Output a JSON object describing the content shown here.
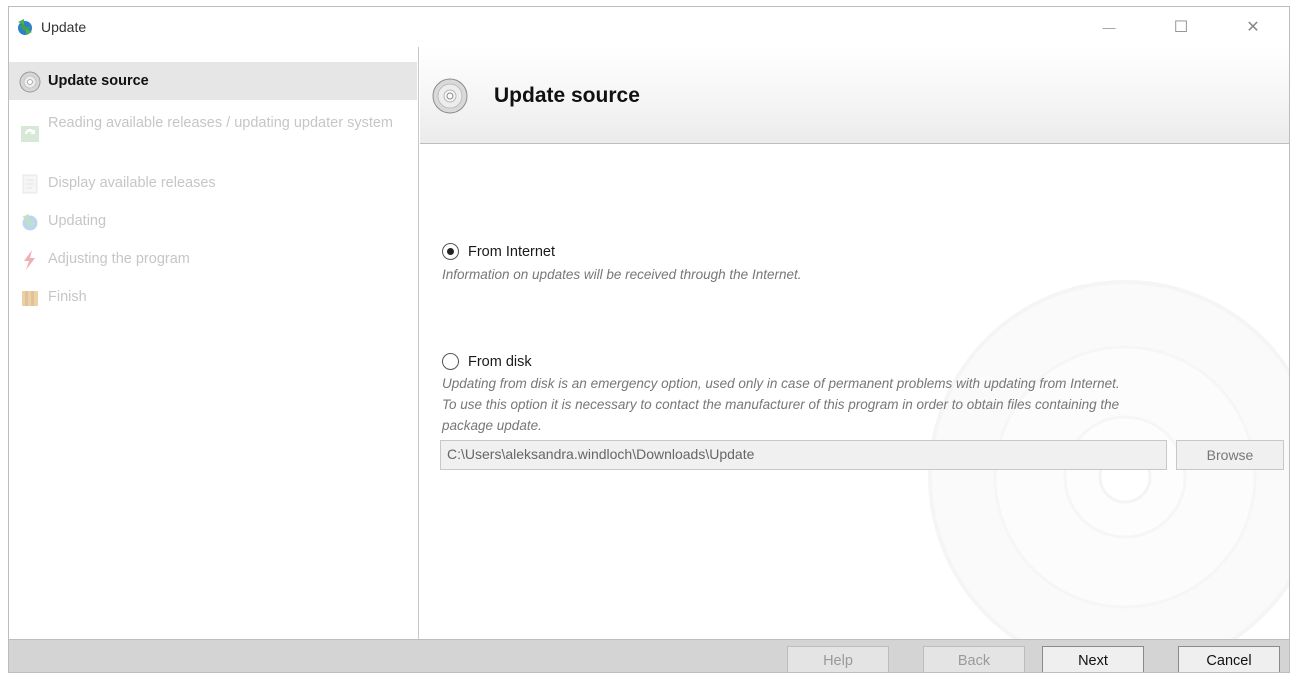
{
  "window": {
    "title": "Update",
    "app_icon": "update-globe-icon",
    "controls": {
      "minimize": "—",
      "maximize": "☐",
      "close": "✕"
    }
  },
  "sidebar": {
    "steps": [
      {
        "label": "Update source",
        "icon": "disc-icon",
        "state": "active"
      },
      {
        "label": "Reading available releases / updating updater system",
        "icon": "refresh-icon",
        "state": "disabled"
      },
      {
        "label": "Display available releases",
        "icon": "document-icon",
        "state": "disabled"
      },
      {
        "label": "Updating",
        "icon": "update-globe-icon",
        "state": "disabled"
      },
      {
        "label": "Adjusting the program",
        "icon": "lightning-icon",
        "state": "disabled"
      },
      {
        "label": "Finish",
        "icon": "finish-flag-icon",
        "state": "disabled"
      }
    ]
  },
  "main": {
    "header_title": "Update source",
    "options": {
      "internet": {
        "label": "From Internet",
        "selected": true,
        "description": "Information on updates will be received through the Internet."
      },
      "disk": {
        "label": "From disk",
        "selected": false,
        "description_lines": [
          "Updating from disk is an emergency option, used only in case of permanent problems with updating from Internet.",
          "To use this option it is necessary to contact the manufacturer of this program in order to obtain files containing the",
          "package update."
        ],
        "path": "C:\\Users\\aleksandra.windloch\\Downloads\\Update",
        "browse_label": "Browse"
      }
    }
  },
  "footer": {
    "help_label": "Help",
    "back_label": "Back",
    "next_label": "Next",
    "cancel_label": "Cancel"
  }
}
